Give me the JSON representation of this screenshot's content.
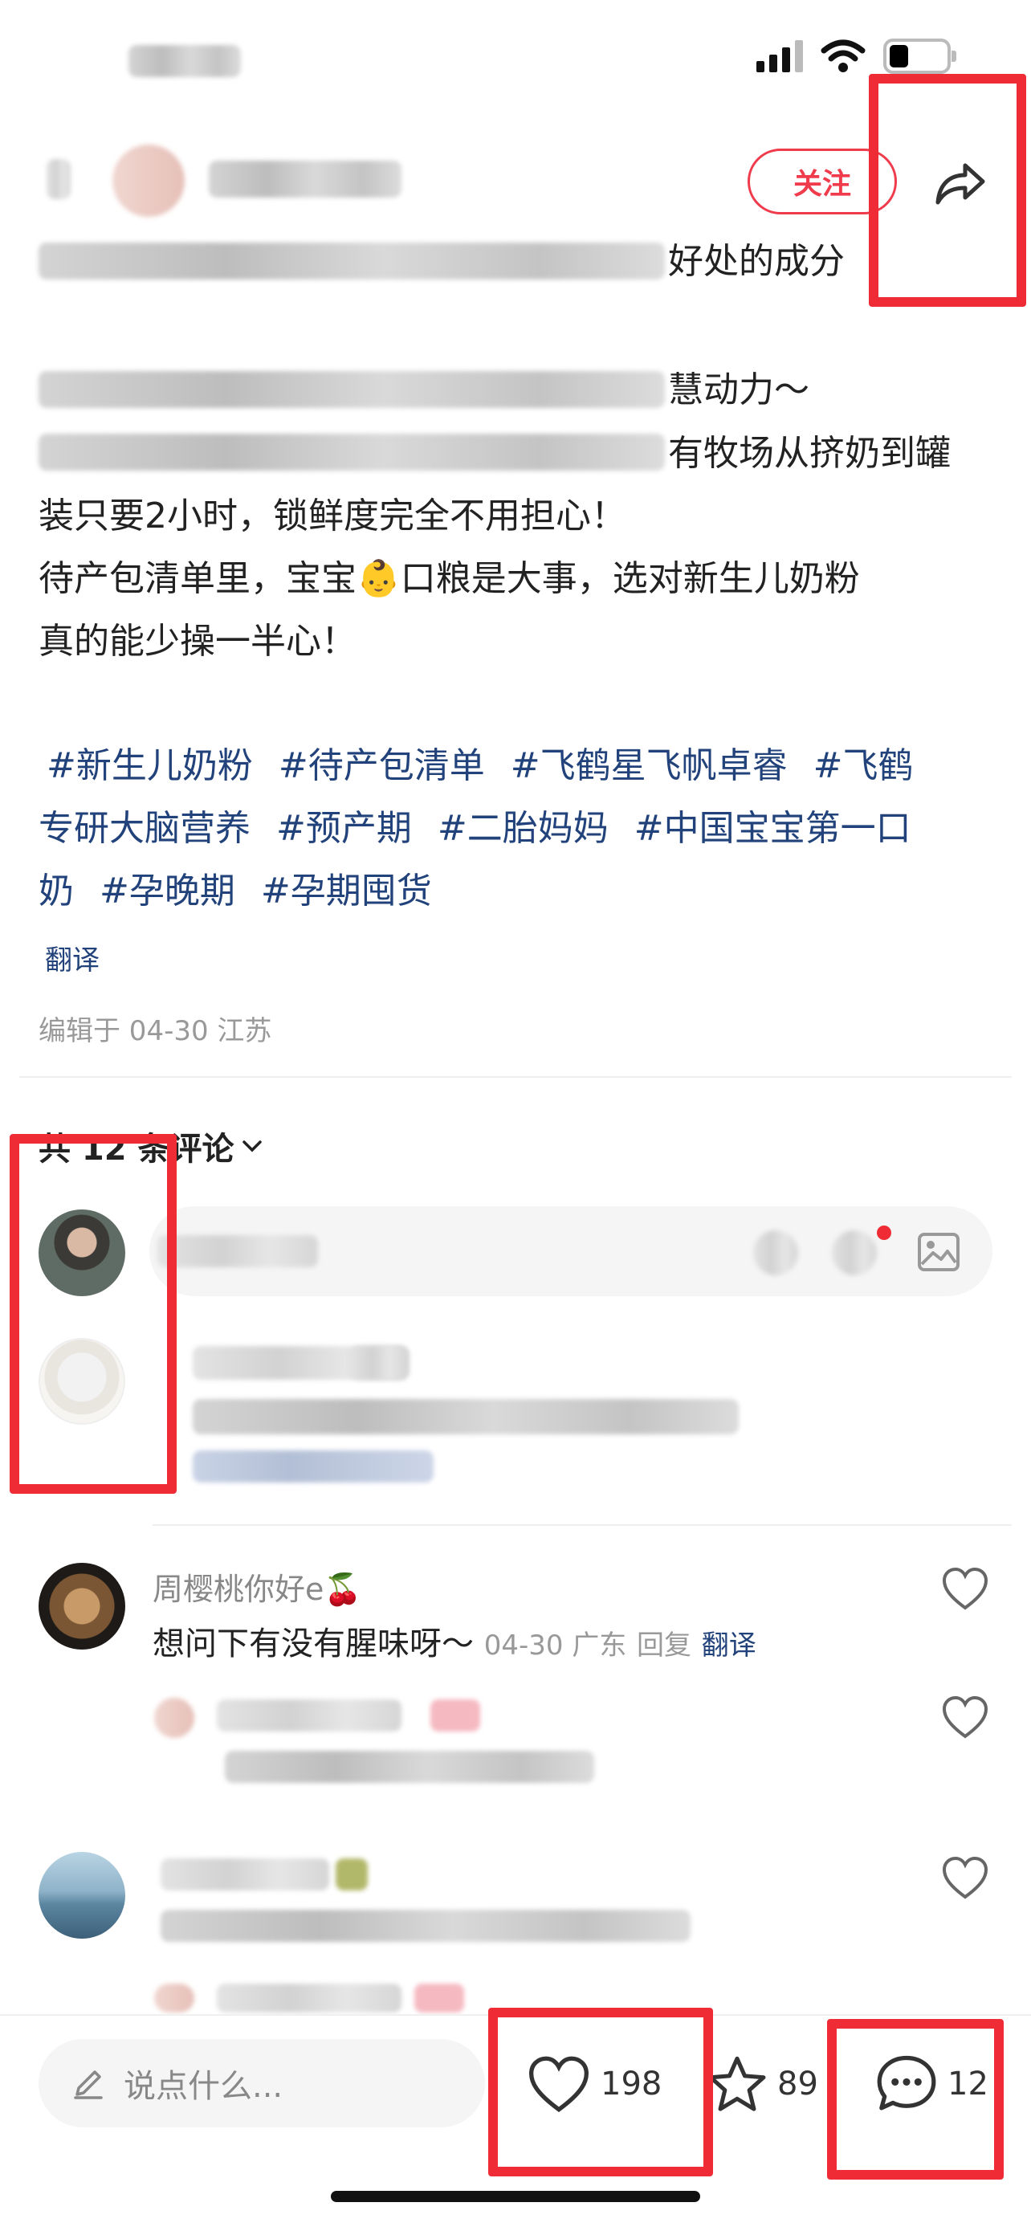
{
  "header": {
    "follow_label": "关注"
  },
  "post": {
    "lines": [
      "好处的成分",
      "慧动力～",
      "有牧场从挤奶到罐",
      "装只要2小时，锁鲜度完全不用担心！",
      "待产包清单里，宝宝👶口粮是大事，选对新生儿奶粉",
      "真的能少操一半心！"
    ],
    "tags_line1": [
      "#新生儿奶粉",
      "#待产包清单",
      "#飞鹤星飞帆卓睿",
      "#飞鹤"
    ],
    "tags_line2": [
      "专研大脑营养",
      "#预产期",
      "#二胎妈妈",
      "#中国宝宝第一口"
    ],
    "tags_line3": [
      "奶",
      "#孕晚期",
      "#孕期囤货"
    ],
    "translate_label": "翻译",
    "edited_info": "编辑于 04-30 江苏"
  },
  "comments": {
    "header_label": "共 12 条评论",
    "items": [
      {
        "name": "周樱桃你好e🍒",
        "body": "想问下有没有腥味呀～",
        "meta": "04-30 广东",
        "reply_label": "回复",
        "translate_label": "翻译"
      }
    ]
  },
  "bottom_bar": {
    "input_placeholder": "说点什么...",
    "like_count": "198",
    "star_count": "89",
    "comment_count": "12"
  },
  "colors": {
    "accent_red": "#ef3b4b",
    "tag_blue": "#21427a",
    "annotation_red": "#ef2c36"
  },
  "icons": [
    "signal-icon",
    "wifi-icon",
    "battery-icon",
    "share-icon",
    "chevron-down-icon",
    "emoji-icon",
    "at-icon",
    "image-icon",
    "heart-icon",
    "pencil-icon",
    "star-icon",
    "comment-icon"
  ]
}
